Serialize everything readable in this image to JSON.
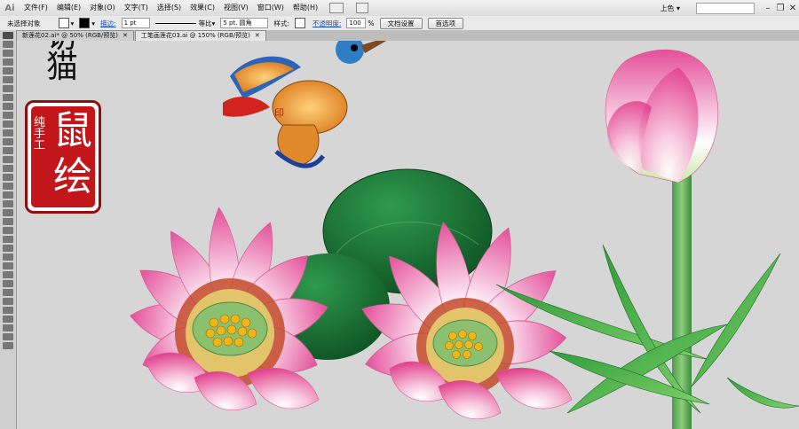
{
  "app": {
    "logo": "Ai",
    "workspace": "上色 ▾"
  },
  "menu": [
    "文件(F)",
    "编辑(E)",
    "对象(O)",
    "文字(T)",
    "选择(S)",
    "效果(C)",
    "视图(V)",
    "窗口(W)",
    "帮助(H)"
  ],
  "controlbar": {
    "selection_label": "未选择对象",
    "stroke_label": "描边:",
    "stroke_value": "1 pt",
    "line_profile": "等比",
    "brush_value": "5 pt. 圆角",
    "style_label": "样式:",
    "opacity_label": "不透明度:",
    "opacity_value": "100",
    "opacity_unit": "%",
    "doc_setup_button": "文档设置",
    "preferences_button": "首选项"
  },
  "tabs": [
    {
      "label": "新莲花02.ai* @ 50% (RGB/预览)",
      "active": false
    },
    {
      "label": "工笔画莲花03.ai @ 150% (RGB/预览)",
      "active": true
    }
  ],
  "artwork": {
    "title_partial": "访",
    "title_char": "猫",
    "seal_main": "鼠",
    "seal_main2": "绘",
    "seal_side": "纯手工"
  },
  "colors": {
    "seal_red": "#c2161a",
    "lotus_pink": "#e8559a",
    "leaf_green": "#1f7a36"
  }
}
